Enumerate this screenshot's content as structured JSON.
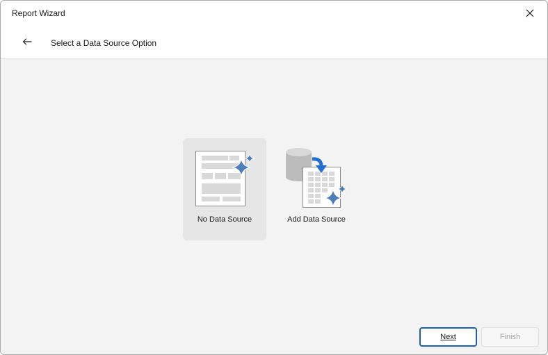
{
  "window": {
    "title": "Report Wizard"
  },
  "header": {
    "title": "Select a Data Source Option"
  },
  "options": [
    {
      "label": "No Data Source",
      "selected": true
    },
    {
      "label": "Add Data Source",
      "selected": false
    }
  ],
  "footer": {
    "next_label": "Next",
    "finish_label": "Finish"
  },
  "icons": {
    "close": "close-icon",
    "back": "arrow-left-icon",
    "no_data_source": "blank-report-icon",
    "add_data_source": "database-report-icon"
  },
  "colors": {
    "accent": "#1f5fa8",
    "sparkle": "#4f7fb8",
    "arrow": "#1f6fd0"
  }
}
